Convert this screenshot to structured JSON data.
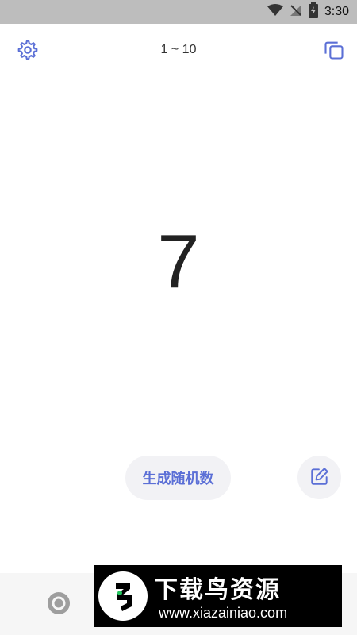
{
  "status_bar": {
    "time": "3:30",
    "icons": [
      "wifi-icon",
      "no-signal-icon",
      "battery-charging-icon"
    ]
  },
  "header": {
    "range_text": "1 ~ 10",
    "left_icon": "gear-icon",
    "right_icon": "copy-icon"
  },
  "main": {
    "result": "7"
  },
  "actions": {
    "generate_label": "生成随机数",
    "edit_icon": "edit-icon"
  },
  "colors": {
    "accent": "#5b6fd6",
    "status_bar_bg": "#bdbdbd",
    "button_bg": "#f2f2f5"
  },
  "watermark": {
    "title": "下载鸟资源",
    "url": "www.xiazainiao.com"
  }
}
